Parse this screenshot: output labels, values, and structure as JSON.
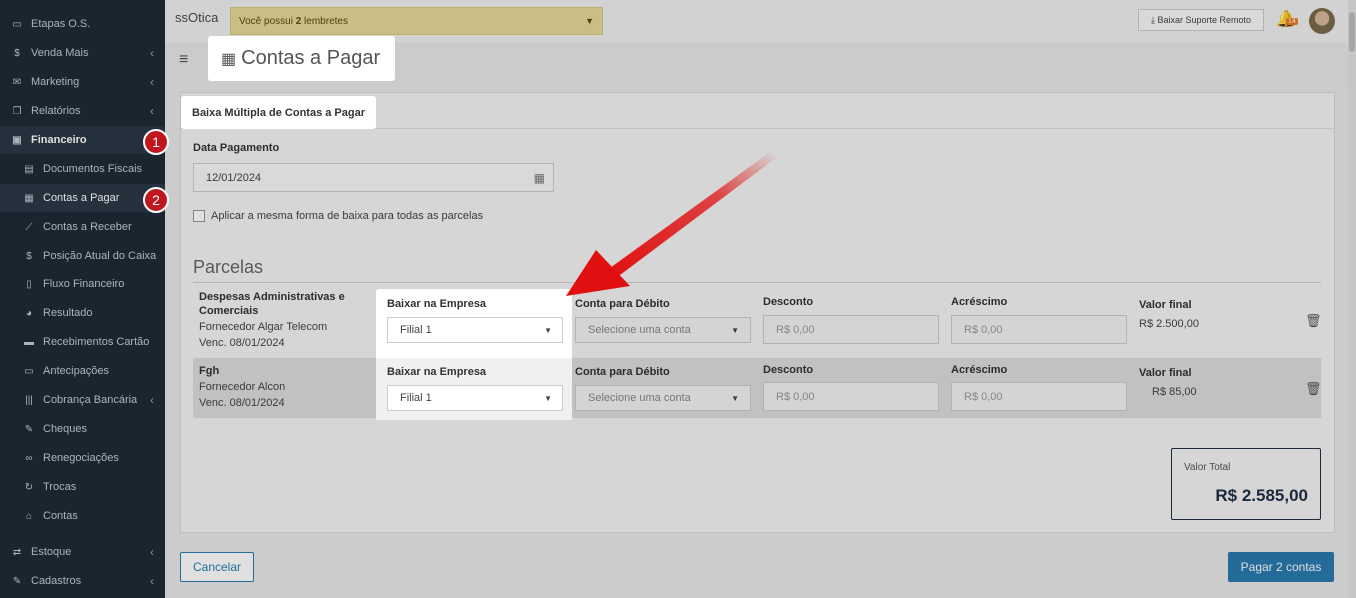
{
  "sidebar": {
    "items": [
      {
        "label": "Etapas O.S.",
        "icon": "tablet-icon",
        "glyph": "▭",
        "chevron": false
      },
      {
        "label": "Venda Mais",
        "icon": "dollar-icon",
        "glyph": "$",
        "chevron": true
      },
      {
        "label": "Marketing",
        "icon": "chat-icon",
        "glyph": "✉",
        "chevron": true
      },
      {
        "label": "Relatórios",
        "icon": "copy-icon",
        "glyph": "❐",
        "chevron": true
      },
      {
        "label": "Financeiro",
        "icon": "money-icon",
        "glyph": "▣",
        "chevron": false
      },
      {
        "label": "Documentos Fiscais",
        "icon": "document-icon",
        "glyph": "▤",
        "chevron": false
      },
      {
        "label": "Contas a Pagar",
        "icon": "calculator-icon",
        "glyph": "▦",
        "chevron": false
      },
      {
        "label": "Contas a Receber",
        "icon": "line-chart-icon",
        "glyph": "⟋",
        "chevron": false
      },
      {
        "label": "Posição Atual do Caixa",
        "icon": "dollar-icon",
        "glyph": "$",
        "chevron": false
      },
      {
        "label": "Fluxo Financeiro",
        "icon": "file-icon",
        "glyph": "▯",
        "chevron": false
      },
      {
        "label": "Resultado",
        "icon": "pie-chart-icon",
        "glyph": "◕",
        "chevron": false
      },
      {
        "label": "Recebimentos Cartão",
        "icon": "credit-card-icon",
        "glyph": "▬",
        "chevron": false
      },
      {
        "label": "Antecipações",
        "icon": "money-icon",
        "glyph": "▭",
        "chevron": false
      },
      {
        "label": "Cobrança Bancária",
        "icon": "barcode-icon",
        "glyph": "|||",
        "chevron": true
      },
      {
        "label": "Cheques",
        "icon": "edit-icon",
        "glyph": "✎",
        "chevron": false
      },
      {
        "label": "Renegociações",
        "icon": "handshake-icon",
        "glyph": "∞",
        "chevron": false
      },
      {
        "label": "Trocas",
        "icon": "refresh-icon",
        "glyph": "↻",
        "chevron": false
      },
      {
        "label": "Contas",
        "icon": "bank-icon",
        "glyph": "⌂",
        "chevron": false
      },
      {
        "label": "Estoque",
        "icon": "exchange-icon",
        "glyph": "⇄",
        "chevron": true
      },
      {
        "label": "Cadastros",
        "icon": "edit-icon",
        "glyph": "✎",
        "chevron": true
      }
    ],
    "chevron_glyph": "‹"
  },
  "header": {
    "logo_text": "ssOtica",
    "reminder_prefix": "Você possui ",
    "reminder_count": "2",
    "reminder_suffix": " lembretes",
    "support_button": "⤓ Baixar Suporte Remoto",
    "bell_badge": "14",
    "page_title": "Contas a Pagar",
    "menu_glyph": "≡",
    "title_icon_glyph": "▦"
  },
  "form": {
    "tab_label": "Baixa Múltipla de Contas a Pagar",
    "date_label": "Data Pagamento",
    "date_value": "12/01/2024",
    "calendar_glyph": "▦",
    "checkbox_label": "Aplicar a mesma forma de baixa para todas as parcelas",
    "parcelas_title": "Parcelas"
  },
  "parcelas": [
    {
      "title": "Despesas Administrativas e Comerciais",
      "supplier": "Fornecedor Algar Telecom",
      "due": "Venc. 08/01/2024",
      "company_label": "Baixar na Empresa",
      "company_value": "Filial 1",
      "account_label": "Conta para Débito",
      "account_placeholder": "Selecione uma conta",
      "discount_label": "Desconto",
      "discount_placeholder": "R$ 0,00",
      "surcharge_label": "Acréscimo",
      "surcharge_placeholder": "R$ 0,00",
      "final_label": "Valor final",
      "final_value": "R$ 2.500,00"
    },
    {
      "title": "Fgh",
      "supplier": "Fornecedor Alcon",
      "due": "Venc. 08/01/2024",
      "company_label": "Baixar na Empresa",
      "company_value": "Filial 1",
      "account_label": "Conta para Débito",
      "account_placeholder": "Selecione uma conta",
      "discount_label": "Desconto",
      "discount_placeholder": "R$ 0,00",
      "surcharge_label": "Acréscimo",
      "surcharge_placeholder": "R$ 0,00",
      "final_label": "Valor final",
      "final_value": "R$ 85,00"
    }
  ],
  "total": {
    "label": "Valor Total",
    "value": "R$ 2.585,00"
  },
  "buttons": {
    "cancel": "Cancelar",
    "pay": "Pagar 2 contas"
  },
  "steps": [
    "1",
    "2"
  ],
  "glyphs": {
    "caret": "▼",
    "trash": "🗑"
  },
  "colors": {
    "sidebar_bg": "#1f2b37",
    "accent": "#2a7ab0",
    "step_badge": "#c0171e",
    "arrow": "#e01010",
    "reminder_bg": "#e6d99a"
  }
}
